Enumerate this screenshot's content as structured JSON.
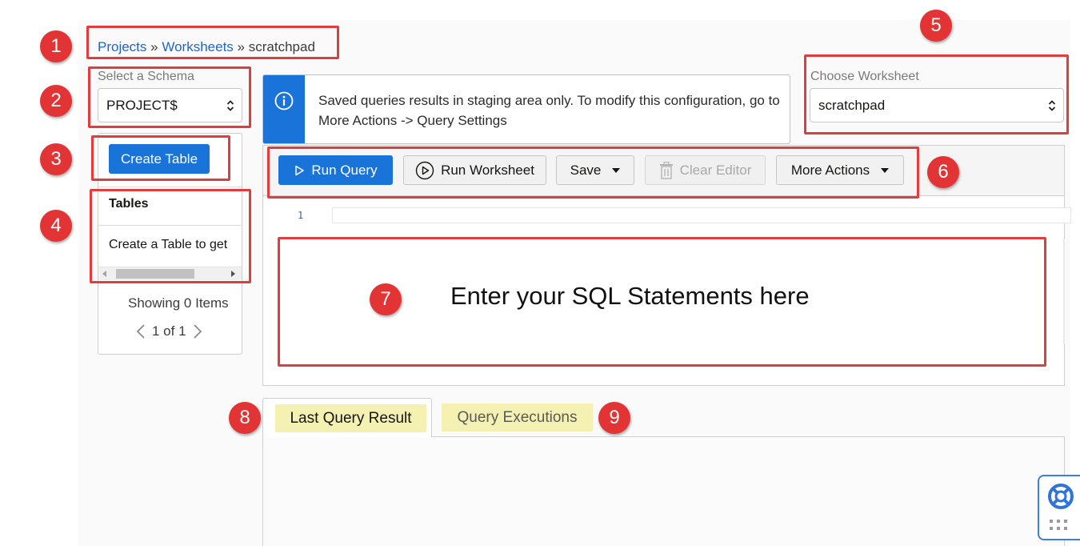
{
  "breadcrumb": {
    "projects": "Projects",
    "sep1": "»",
    "worksheets": "Worksheets",
    "sep2": "»",
    "current": "scratchpad"
  },
  "schema": {
    "label": "Select a Schema",
    "value": "PROJECT$"
  },
  "worksheet": {
    "label": "Choose Worksheet",
    "value": "scratchpad"
  },
  "left_panel": {
    "create_table_label": "Create Table",
    "tables_header": "Tables",
    "empty_text": "Create a Table to get",
    "showing": "Showing 0 Items",
    "pager": "1 of 1"
  },
  "banner": {
    "message": "Saved queries results in staging area only. To modify this configuration, go to More Actions -> Query Settings",
    "icon": "info-icon"
  },
  "toolbar": {
    "run_query": "Run Query",
    "run_worksheet": "Run Worksheet",
    "save": "Save",
    "clear_editor": "Clear Editor",
    "more_actions": "More Actions"
  },
  "editor": {
    "line_number": "1",
    "placeholder": "Enter your SQL Statements here"
  },
  "tabs": {
    "last_query_result": "Last Query Result",
    "query_executions": "Query Executions"
  },
  "annotations": {
    "b1": "1",
    "b2": "2",
    "b3": "3",
    "b4": "4",
    "b5": "5",
    "b6": "6",
    "b7": "7",
    "b8": "8",
    "b9": "9"
  },
  "colors": {
    "accent": "#1a73d9",
    "link": "#1e66c9",
    "annotation": "#e23434",
    "tab_highlight": "#f5f1b2"
  }
}
